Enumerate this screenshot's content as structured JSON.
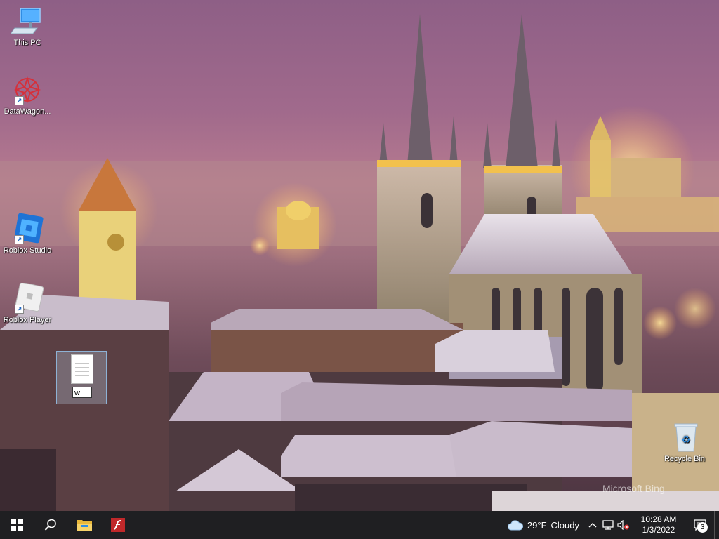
{
  "desktop": {
    "icons": [
      {
        "label": "This PC",
        "icon": "this-pc-icon"
      },
      {
        "label": "DataWagon...",
        "icon": "datawagon-icon"
      },
      {
        "label": "Roblox Studio",
        "icon": "roblox-studio-icon"
      },
      {
        "label": "Roblox Player",
        "icon": "roblox-player-icon"
      }
    ],
    "rename_text": "w",
    "recycle_bin": {
      "label": "Recycle Bin",
      "icon": "recycle-bin-icon"
    },
    "watermark": "Microsoft Bing"
  },
  "taskbar": {
    "start_icon": "windows-start-icon",
    "search_icon": "search-icon",
    "pinned": [
      {
        "name": "File Explorer",
        "icon": "file-explorer-icon"
      },
      {
        "name": "Adobe Flash",
        "icon": "flash-icon"
      }
    ],
    "weather": {
      "temp": "29°F",
      "condition": "Cloudy",
      "icon": "cloud-icon"
    },
    "tray": {
      "chevron_icon": "chevron-up-icon",
      "network_icon": "network-icon",
      "volume_icon": "volume-muted-icon"
    },
    "clock": {
      "time": "10:28 AM",
      "date": "1/3/2022"
    },
    "notifications": {
      "count": "3",
      "icon": "action-center-icon"
    }
  },
  "colors": {
    "taskbar_bg": "#1f1f22",
    "accent": "#76b9ed",
    "flash_red": "#c0282a"
  }
}
